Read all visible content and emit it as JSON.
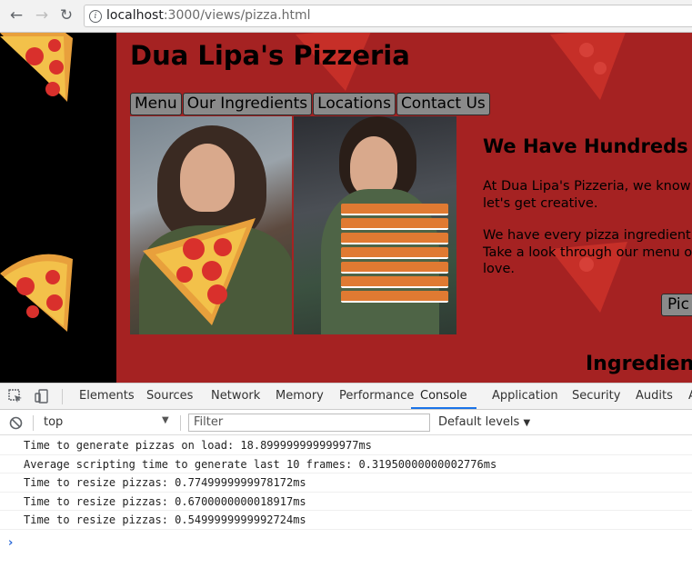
{
  "browser": {
    "url_host": "localhost",
    "url_path": ":3000/views/pizza.html",
    "info_icon": "info-icon"
  },
  "page": {
    "title": "Dua Lipa's Pizzeria",
    "nav": [
      "Menu",
      "Our Ingredients",
      "Locations",
      "Contact Us"
    ],
    "section_heading": "We Have Hundreds o",
    "paragraph_1": "At Dua Lipa's Pizzeria, we know\nlet's get creative.",
    "paragraph_2": "We have every pizza ingredient\nTake a look through our menu o\nlove.",
    "pick_button": "Pic",
    "ingredients_heading": "Ingredients",
    "colors": {
      "background": "#a52222",
      "sidebar": "#000000",
      "pizza_crust": "#e8a03c",
      "pepperoni": "#d9302c"
    }
  },
  "devtools": {
    "tabs": [
      "Elements",
      "Sources",
      "Network",
      "Memory",
      "Performance",
      "Console",
      "Application",
      "Security",
      "Audits",
      "A"
    ],
    "active_tab": "Console",
    "context": "top",
    "filter_placeholder": "Filter",
    "levels": "Default levels",
    "logs": [
      "Time to generate pizzas on load: 18.899999999999977ms",
      "Average scripting time to generate last 10 frames: 0.31950000000002776ms",
      "Time to resize pizzas: 0.7749999999978172ms",
      "Time to resize pizzas: 0.6700000000018917ms",
      "Time to resize pizzas: 0.5499999999992724ms"
    ],
    "prompt": "›"
  }
}
